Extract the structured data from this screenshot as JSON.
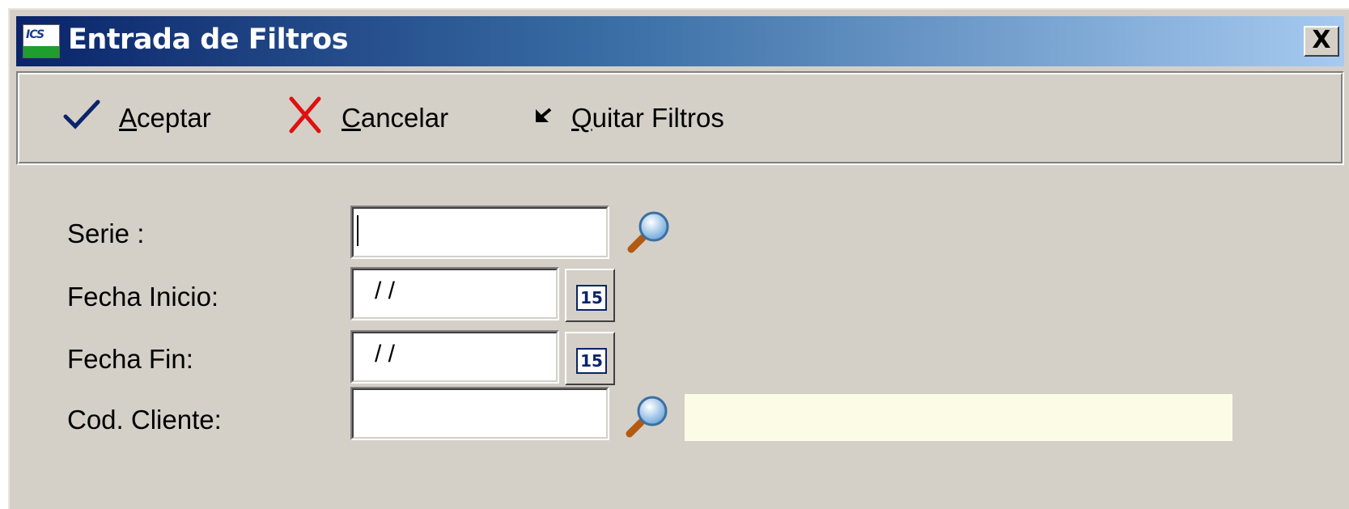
{
  "window": {
    "title": "Entrada de Filtros",
    "close_label": "X",
    "app_icon_text": "ICS"
  },
  "toolbar": {
    "accept_label": "Aceptar",
    "accept_mnemonic": "A",
    "accept_rest": "ceptar",
    "cancel_label": "Cancelar",
    "cancel_mnemonic": "C",
    "cancel_rest": "ancelar",
    "clear_label": "Quitar Filtros",
    "clear_mnemonic": "Q",
    "clear_rest": "uitar Filtros"
  },
  "form": {
    "serie_label": "Serie :",
    "serie_value": "",
    "fecha_inicio_label": "Fecha Inicio:",
    "fecha_inicio_value": "/ /",
    "fecha_fin_label": "Fecha Fin:",
    "fecha_fin_value": "/ /",
    "cod_cliente_label": "Cod. Cliente:",
    "cod_cliente_value": "",
    "cliente_desc_value": "",
    "calendar_icon_text": "15"
  },
  "icons": {
    "accept": "checkmark-icon",
    "cancel": "x-icon",
    "clear": "arrow-icon",
    "search": "magnifier-icon",
    "calendar": "calendar-icon"
  },
  "colors": {
    "title_gradient_start": "#0a246a",
    "title_gradient_end": "#a6caf0",
    "window_bg": "#d4d0c8",
    "accept_check": "#0a246a",
    "cancel_x": "#e01010",
    "desc_box_bg": "#fcfce6"
  }
}
